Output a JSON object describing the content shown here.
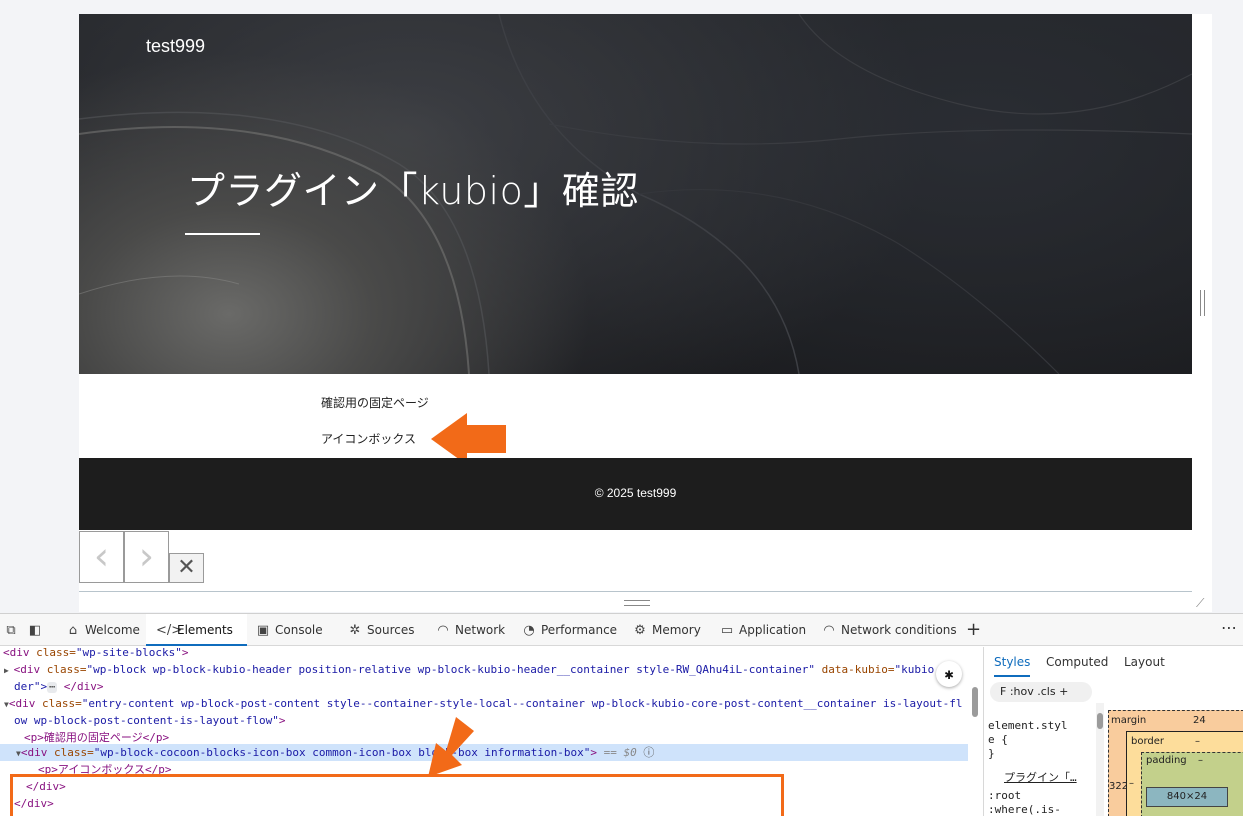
{
  "page": {
    "site_title": "test999",
    "hero_heading": "プラグイン「kubio」確認",
    "content_lines": [
      "確認用の固定ページ",
      "アイコンボックス"
    ],
    "footer_text": "© 2025 test999",
    "nav_prev": "‹",
    "nav_next": "›",
    "nav_close": "✕"
  },
  "devtools": {
    "tabs": [
      {
        "label": "Welcome",
        "icon": "home-icon"
      },
      {
        "label": "Elements",
        "icon": "code-icon"
      },
      {
        "label": "Console",
        "icon": "console-icon"
      },
      {
        "label": "Sources",
        "icon": "bug-icon"
      },
      {
        "label": "Network",
        "icon": "wifi-icon"
      },
      {
        "label": "Performance",
        "icon": "gauge-icon"
      },
      {
        "label": "Memory",
        "icon": "chip-icon"
      },
      {
        "label": "Application",
        "icon": "window-icon"
      },
      {
        "label": "Network conditions",
        "icon": "wifi-gear-icon"
      }
    ],
    "active_tab": "Elements",
    "more": "⋯",
    "dom": {
      "l1_tag": "<div ",
      "l1_attr": "class=",
      "l1_val": "\"wp-site-blocks\"",
      "l1_end": ">",
      "l2_tag": "<div ",
      "l2_attr": "class=",
      "l2_val": "\"wp-block wp-block-kubio-header  position-relative wp-block-kubio-header__container style-RW_QAhu4iL-container\"",
      "l2_attr2": " data-kubio=",
      "l2_val2": "\"kubio",
      "l2b_val": "der\">",
      "l2b_ellipsis": "⋯",
      "l2b_end": "</div>",
      "l3_tag": "<div ",
      "l3_attr": "class=",
      "l3_val": "\"entry-content wp-block-post-content style--container-style-local--container wp-block-kubio-core-post-content__container is-layout-fl",
      "l3b_val": "ow wp-block-post-content-is-layout-flow\"",
      "l3b_end": ">",
      "l4": "<p>確認用の固定ページ</p>",
      "l5_tag": "<div ",
      "l5_attr": "class=",
      "l5_val": "\"wp-block-cocoon-blocks-icon-box common-icon-box block-box information-box\"",
      "l5_end": ">",
      "l5_dollar": "== $0",
      "l6": "<p>アイコンボックス</p>",
      "l7": "</div>",
      "l8": "</div>"
    },
    "styles": {
      "tabs": [
        "Styles",
        "Computed",
        "Layout"
      ],
      "filter": "F  :hov  .cls  +",
      "code_lines": [
        "element.styl",
        "e {",
        "}",
        "プラグイン「…",
        ":root",
        ":where(.is-"
      ],
      "box_model": {
        "margin_label": "margin",
        "margin_value": "24",
        "border_label": "border",
        "border_value": "–",
        "padding_label": "padding",
        "padding_value": "–",
        "content": "840×24",
        "left_value": "322",
        "dash": "–"
      }
    }
  },
  "colors": {
    "annotation": "#f26a18",
    "accent": "#0f6cbd",
    "selection": "#cfe3fb"
  }
}
